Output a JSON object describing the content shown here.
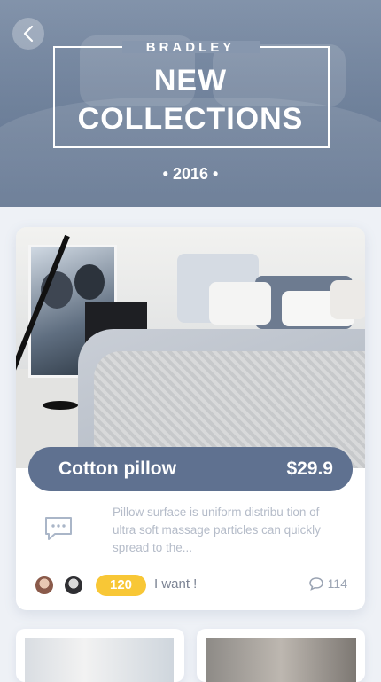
{
  "header": {
    "brand": "BRADLEY",
    "title_line1": "NEW",
    "title_line2": "COLLECTIONS",
    "year": "• 2016 •"
  },
  "product": {
    "name": "Cotton pillow",
    "price": "$29.9",
    "description": "Pillow surface is uniform distribu tion of ultra soft massage particles can quickly spread to the...",
    "want_count": "120",
    "want_label": "I want !",
    "comment_count": "114"
  },
  "icons": {
    "back": "chevron-left-icon",
    "message": "message-dots-icon",
    "comment": "comment-bubble-icon"
  },
  "colors": {
    "accent": "#5f7190",
    "badge": "#f8c736",
    "muted_text": "#b5bcc9"
  }
}
